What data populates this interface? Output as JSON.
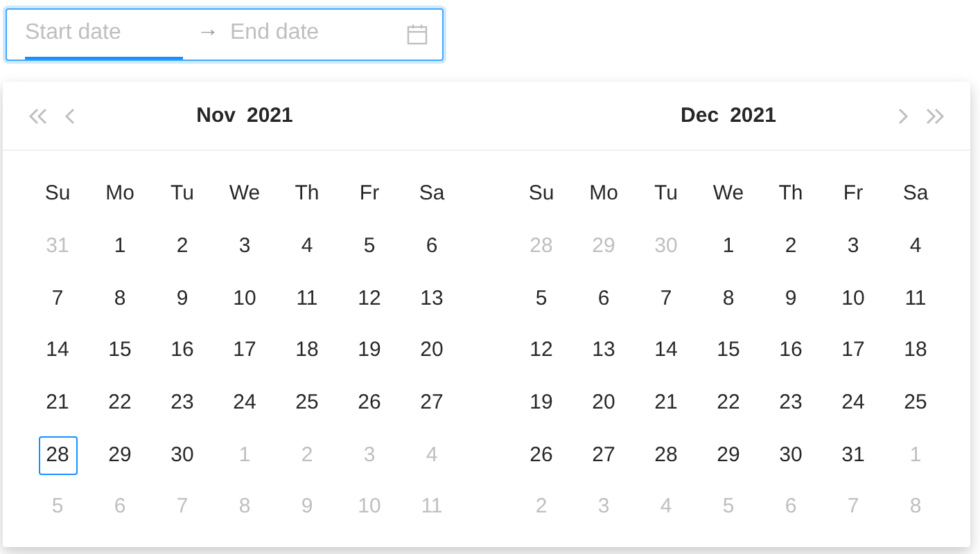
{
  "range_input": {
    "start": {
      "placeholder": "Start date",
      "selected": true
    },
    "separator": "→",
    "end": {
      "placeholder": "End date",
      "selected": false
    }
  },
  "panels": [
    {
      "month": "Nov",
      "year": "2021",
      "kind": "first",
      "weekdays": [
        "Su",
        "Mo",
        "Tu",
        "We",
        "Th",
        "Fr",
        "Sa"
      ],
      "weeks": [
        [
          {
            "day": "31",
            "in_month": false,
            "today": false
          },
          {
            "day": "1",
            "in_month": true,
            "today": false
          },
          {
            "day": "2",
            "in_month": true,
            "today": false
          },
          {
            "day": "3",
            "in_month": true,
            "today": false
          },
          {
            "day": "4",
            "in_month": true,
            "today": false
          },
          {
            "day": "5",
            "in_month": true,
            "today": false
          },
          {
            "day": "6",
            "in_month": true,
            "today": false
          }
        ],
        [
          {
            "day": "7",
            "in_month": true,
            "today": false
          },
          {
            "day": "8",
            "in_month": true,
            "today": false
          },
          {
            "day": "9",
            "in_month": true,
            "today": false
          },
          {
            "day": "10",
            "in_month": true,
            "today": false
          },
          {
            "day": "11",
            "in_month": true,
            "today": false
          },
          {
            "day": "12",
            "in_month": true,
            "today": false
          },
          {
            "day": "13",
            "in_month": true,
            "today": false
          }
        ],
        [
          {
            "day": "14",
            "in_month": true,
            "today": false
          },
          {
            "day": "15",
            "in_month": true,
            "today": false
          },
          {
            "day": "16",
            "in_month": true,
            "today": false
          },
          {
            "day": "17",
            "in_month": true,
            "today": false
          },
          {
            "day": "18",
            "in_month": true,
            "today": false
          },
          {
            "day": "19",
            "in_month": true,
            "today": false
          },
          {
            "day": "20",
            "in_month": true,
            "today": false
          }
        ],
        [
          {
            "day": "21",
            "in_month": true,
            "today": false
          },
          {
            "day": "22",
            "in_month": true,
            "today": false
          },
          {
            "day": "23",
            "in_month": true,
            "today": false
          },
          {
            "day": "24",
            "in_month": true,
            "today": false
          },
          {
            "day": "25",
            "in_month": true,
            "today": false
          },
          {
            "day": "26",
            "in_month": true,
            "today": false
          },
          {
            "day": "27",
            "in_month": true,
            "today": false
          }
        ],
        [
          {
            "day": "28",
            "in_month": true,
            "today": true
          },
          {
            "day": "29",
            "in_month": true,
            "today": false
          },
          {
            "day": "30",
            "in_month": true,
            "today": false
          },
          {
            "day": "1",
            "in_month": false,
            "today": false
          },
          {
            "day": "2",
            "in_month": false,
            "today": false
          },
          {
            "day": "3",
            "in_month": false,
            "today": false
          },
          {
            "day": "4",
            "in_month": false,
            "today": false
          }
        ],
        [
          {
            "day": "5",
            "in_month": false,
            "today": false
          },
          {
            "day": "6",
            "in_month": false,
            "today": false
          },
          {
            "day": "7",
            "in_month": false,
            "today": false
          },
          {
            "day": "8",
            "in_month": false,
            "today": false
          },
          {
            "day": "9",
            "in_month": false,
            "today": false
          },
          {
            "day": "10",
            "in_month": false,
            "today": false
          },
          {
            "day": "11",
            "in_month": false,
            "today": false
          }
        ]
      ]
    },
    {
      "month": "Dec",
      "year": "2021",
      "kind": "last",
      "weekdays": [
        "Su",
        "Mo",
        "Tu",
        "We",
        "Th",
        "Fr",
        "Sa"
      ],
      "weeks": [
        [
          {
            "day": "28",
            "in_month": false,
            "today": false
          },
          {
            "day": "29",
            "in_month": false,
            "today": false
          },
          {
            "day": "30",
            "in_month": false,
            "today": false
          },
          {
            "day": "1",
            "in_month": true,
            "today": false
          },
          {
            "day": "2",
            "in_month": true,
            "today": false
          },
          {
            "day": "3",
            "in_month": true,
            "today": false
          },
          {
            "day": "4",
            "in_month": true,
            "today": false
          }
        ],
        [
          {
            "day": "5",
            "in_month": true,
            "today": false
          },
          {
            "day": "6",
            "in_month": true,
            "today": false
          },
          {
            "day": "7",
            "in_month": true,
            "today": false
          },
          {
            "day": "8",
            "in_month": true,
            "today": false
          },
          {
            "day": "9",
            "in_month": true,
            "today": false
          },
          {
            "day": "10",
            "in_month": true,
            "today": false
          },
          {
            "day": "11",
            "in_month": true,
            "today": false
          }
        ],
        [
          {
            "day": "12",
            "in_month": true,
            "today": false
          },
          {
            "day": "13",
            "in_month": true,
            "today": false
          },
          {
            "day": "14",
            "in_month": true,
            "today": false
          },
          {
            "day": "15",
            "in_month": true,
            "today": false
          },
          {
            "day": "16",
            "in_month": true,
            "today": false
          },
          {
            "day": "17",
            "in_month": true,
            "today": false
          },
          {
            "day": "18",
            "in_month": true,
            "today": false
          }
        ],
        [
          {
            "day": "19",
            "in_month": true,
            "today": false
          },
          {
            "day": "20",
            "in_month": true,
            "today": false
          },
          {
            "day": "21",
            "in_month": true,
            "today": false
          },
          {
            "day": "22",
            "in_month": true,
            "today": false
          },
          {
            "day": "23",
            "in_month": true,
            "today": false
          },
          {
            "day": "24",
            "in_month": true,
            "today": false
          },
          {
            "day": "25",
            "in_month": true,
            "today": false
          }
        ],
        [
          {
            "day": "26",
            "in_month": true,
            "today": false
          },
          {
            "day": "27",
            "in_month": true,
            "today": false
          },
          {
            "day": "28",
            "in_month": true,
            "today": false
          },
          {
            "day": "29",
            "in_month": true,
            "today": false
          },
          {
            "day": "30",
            "in_month": true,
            "today": false
          },
          {
            "day": "31",
            "in_month": true,
            "today": false
          },
          {
            "day": "1",
            "in_month": false,
            "today": false
          }
        ],
        [
          {
            "day": "2",
            "in_month": false,
            "today": false
          },
          {
            "day": "3",
            "in_month": false,
            "today": false
          },
          {
            "day": "4",
            "in_month": false,
            "today": false
          },
          {
            "day": "5",
            "in_month": false,
            "today": false
          },
          {
            "day": "6",
            "in_month": false,
            "today": false
          },
          {
            "day": "7",
            "in_month": false,
            "today": false
          },
          {
            "day": "8",
            "in_month": false,
            "today": false
          }
        ]
      ]
    }
  ]
}
